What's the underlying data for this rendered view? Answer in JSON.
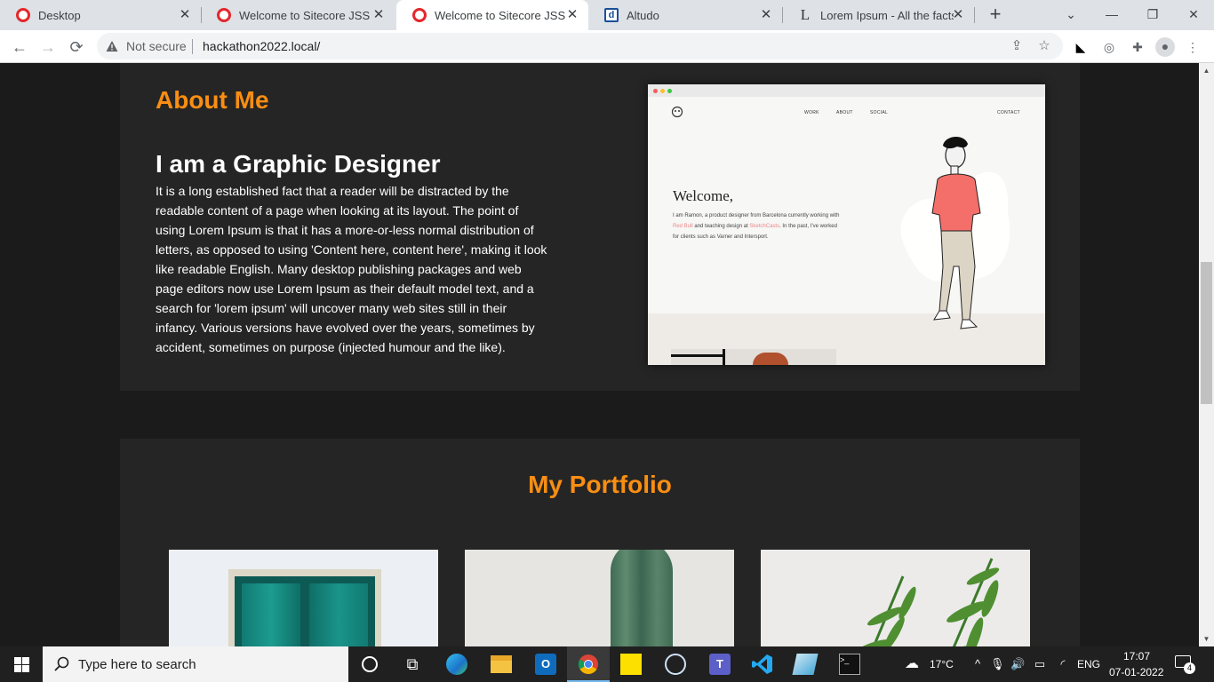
{
  "browser": {
    "tabs": [
      {
        "title": "Desktop",
        "favicon": "opera-icon",
        "active": false
      },
      {
        "title": "Welcome to Sitecore JSS",
        "favicon": "opera-icon",
        "active": false
      },
      {
        "title": "Welcome to Sitecore JSS",
        "favicon": "opera-icon",
        "active": true
      },
      {
        "title": "Altudo",
        "favicon": "d-icon",
        "active": false
      },
      {
        "title": "Lorem Ipsum - All the facts -",
        "favicon": "lipsum-icon",
        "active": false
      }
    ],
    "security_label": "Not secure",
    "url": "hackathon2022.local/"
  },
  "page": {
    "about": {
      "heading": "About Me",
      "subheading": "I am a Graphic Designer",
      "body": "It is a long established fact that a reader will be distracted by the readable content of a page when looking at its layout. The point of using Lorem Ipsum is that it has a more-or-less normal distribution of letters, as opposed to using 'Content here, content here', making it look like readable English. Many desktop publishing packages and web page editors now use Lorem Ipsum as their default model text, and a search for 'lorem ipsum' will uncover many web sites still in their infancy. Various versions have evolved over the years, sometimes by accident, sometimes on purpose (injected humour and the like).",
      "image": {
        "nav": [
          "WORK",
          "ABOUT",
          "SOCIAL"
        ],
        "contact": "CONTACT",
        "welcome": "Welcome,",
        "text_a": "I am Ramon, a product designer from Barcelona currently working with ",
        "link_a": "Red Bull",
        "text_b": " and teaching design at ",
        "link_b": "SketchCasts",
        "text_c": ". In the past, I've worked for clients such as Varner and Intersport."
      }
    },
    "portfolio": {
      "heading": "My Portfolio",
      "cards": [
        "window-photo",
        "cactus-photo",
        "fern-photo"
      ]
    }
  },
  "taskbar": {
    "search_placeholder": "Type here to search",
    "weather": "17°C",
    "language": "ENG",
    "time": "17:07",
    "date": "07-01-2022",
    "notifications": "4"
  },
  "colors": {
    "accent": "#f98e13",
    "page_bg": "#1b1b1b",
    "section_bg": "#252525"
  }
}
